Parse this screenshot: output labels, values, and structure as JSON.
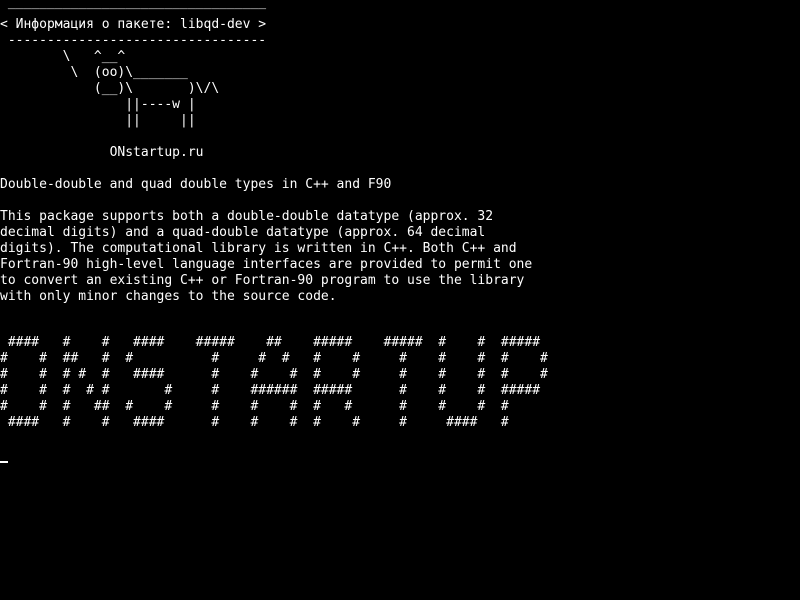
{
  "terminal": {
    "lines": [
      " _________________________________",
      "< Информация о пакете: libqd-dev >",
      " ---------------------------------",
      "        \\   ^__^",
      "         \\  (oo)\\_______",
      "            (__)\\       )\\/\\",
      "                ||----w |",
      "                ||     ||",
      "",
      "              ONstartup.ru",
      "",
      "Double-double and quad double types in C++ and F90",
      "",
      "This package supports both a double-double datatype (approx. 32",
      "decimal digits) and a quad-double datatype (approx. 64 decimal",
      "digits). The computational library is written in C++. Both C++ and",
      "Fortran-90 high-level language interfaces are provided to permit one",
      "to convert an existing C++ or Fortran-90 program to use the library",
      "with only minor changes to the source code.",
      "",
      "",
      " ####   #    #   ####    #####    ##    #####    #####  #    #  #####",
      "#    #  ##   #  #          #     #  #   #    #     #    #    #  #    #",
      "#    #  # #  #   ####      #    #    #  #    #     #    #    #  #    #",
      "#    #  #  # #       #     #    ######  #####      #    #    #  #####",
      "#    #  #   ##  #    #     #    #    #  #   #      #    #    #  #",
      " ####   #    #   ####      #    #    #  #    #     #     ####   #"
    ],
    "foreground_color": "#ffffff",
    "background_color": "#000000"
  }
}
